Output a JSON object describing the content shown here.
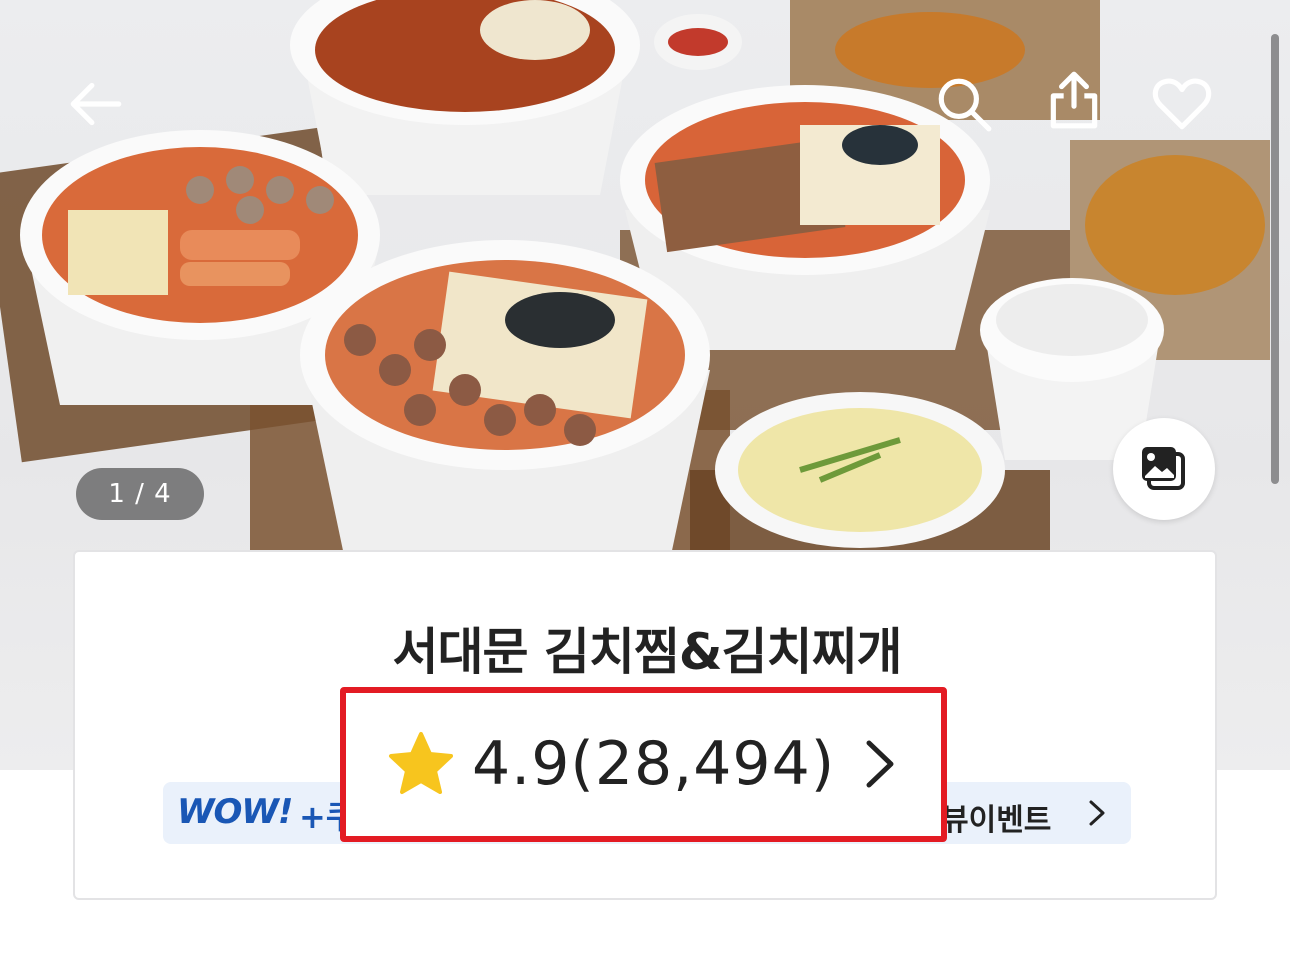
{
  "hero": {
    "image_counter": "1 / 4"
  },
  "nav": {
    "back_icon": "arrow-left-icon",
    "search_icon": "search-icon",
    "share_icon": "share-icon",
    "favorite_icon": "heart-outline-icon",
    "gallery_icon": "photo-gallery-icon"
  },
  "store": {
    "name": "서대문 김치찜&김치찌개",
    "rating": "4.9",
    "review_count": "(28,494)",
    "rating_display": "4.9(28,494)"
  },
  "promo": {
    "wow_label": "WOW!",
    "plus_label": "+쿠",
    "event_text": "뷰이벤트"
  },
  "colors": {
    "highlight": "#e31b23",
    "wow_blue": "#1a57b5",
    "star": "#f7c51e",
    "promo_bg": "#eaf1fb"
  }
}
